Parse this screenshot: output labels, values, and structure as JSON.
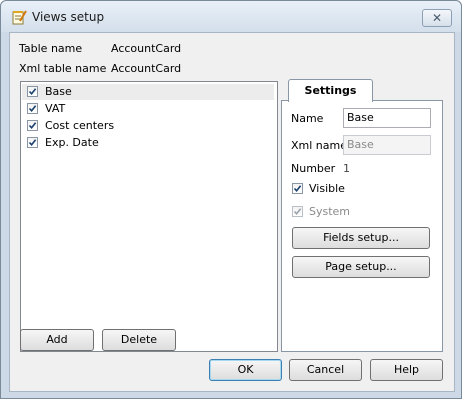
{
  "window": {
    "title": "Views setup",
    "close_symbol": "✕",
    "icon": "notepad-pencil-icon"
  },
  "info": {
    "table_name_label": "Table name",
    "table_name_value": "AccountCard",
    "xml_table_name_label": "Xml table name",
    "xml_table_name_value": "AccountCard"
  },
  "views": [
    {
      "label": "Base",
      "checked": true,
      "selected": true
    },
    {
      "label": "VAT",
      "checked": true,
      "selected": false
    },
    {
      "label": "Cost centers",
      "checked": true,
      "selected": false
    },
    {
      "label": "Exp. Date",
      "checked": true,
      "selected": false
    }
  ],
  "settings": {
    "tab_label": "Settings",
    "name_label": "Name",
    "name_value": "Base",
    "xml_name_label": "Xml name",
    "xml_name_value": "Base",
    "number_label": "Number",
    "number_value": "1",
    "visible_label": "Visible",
    "visible_checked": true,
    "system_label": "System",
    "system_checked": true,
    "fields_setup_label": "Fields setup...",
    "page_setup_label": "Page setup..."
  },
  "buttons": {
    "add": "Add",
    "delete": "Delete",
    "ok": "OK",
    "cancel": "Cancel",
    "help": "Help"
  }
}
